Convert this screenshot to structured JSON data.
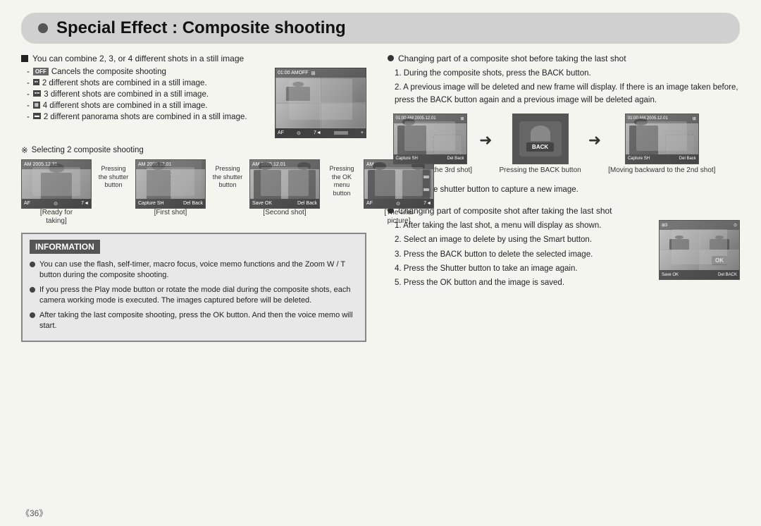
{
  "title": "Special Effect : Composite shooting",
  "left": {
    "intro": "You can combine 2, 3, or 4 different shots in a still image",
    "items": [
      {
        "icon": "OFF",
        "text": "Cancels the composite shooting"
      },
      {
        "icon": "2",
        "text": "2 different shots are combined in a still image."
      },
      {
        "icon": "3",
        "text": "3 different shots are combined in a still image."
      },
      {
        "icon": "4",
        "text": "4 different shots are combined in a still image."
      },
      {
        "icon": "P",
        "text": "2 different panorama shots are combined in a still image."
      }
    ],
    "selectingLabel": "Selecting 2 composite shooting",
    "steps": [
      {
        "label": "Ready for taking",
        "caption": "Pressing\nthe shutter\nbutton"
      },
      {
        "label": "First shot",
        "caption": "Pressing\nthe shutter\nbutton"
      },
      {
        "label": "Second shot",
        "caption": "Pressing\nthe OK\nmenu button"
      },
      {
        "label": "The final picture",
        "caption": ""
      }
    ]
  },
  "information": {
    "header": "INFORMATION",
    "items": [
      "You can use the flash, self-timer, macro focus, voice memo functions and the Zoom W / T button during the composite shooting.",
      "If you press the Play mode button or rotate the mode dial during the composite shots, each camera working mode is executed. The images captured before will be deleted.",
      "After taking the last composite shooting, press the OK button. And then the voice memo will start."
    ]
  },
  "right": {
    "section1": {
      "bullet": "Changing part of a composite shot before taking the last shot",
      "numbered": [
        "During the composite shots, press the BACK button.",
        "A previous image will be deleted and new frame will display. If there is an image taken before, press the BACK button again and a previous image will be deleted again."
      ],
      "back_button_label": "BACK",
      "pressing_label": "Pressing the BACK button",
      "caption_before": "[Before taking the 3rd shot]",
      "caption_after": "[Moving backward to the 2nd shot]"
    },
    "step3": "3. Press the shutter button to capture a new image.",
    "section2": {
      "bullet": "Changing part of composite shot after taking the last shot",
      "numbered": [
        "After taking the last shot, a menu will display as shown.",
        "Select an image  to delete by using the Smart button.",
        "Press the BACK button to delete the selected image.",
        "Press the Shutter button to take an image again.",
        "Press the OK button and the image is saved."
      ]
    }
  },
  "page_number": "《36》"
}
